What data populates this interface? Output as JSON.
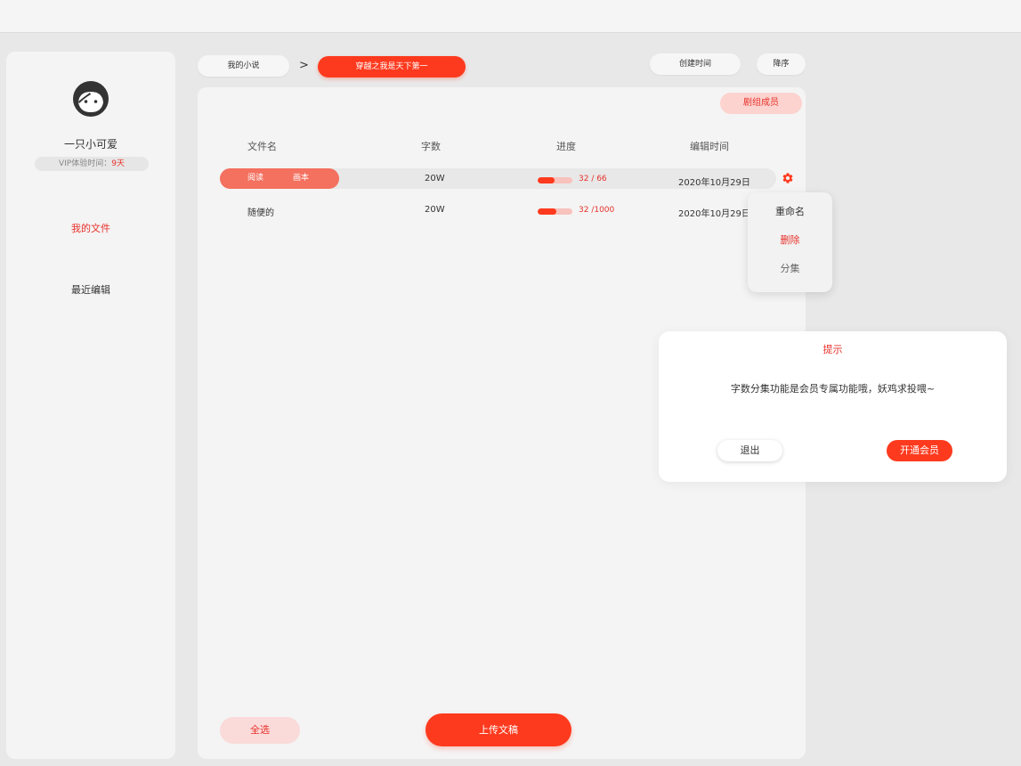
{
  "sidebar": {
    "username": "一只小可爱",
    "vip_label": "VIP体验时间：",
    "vip_days": "9天",
    "nav": [
      {
        "label": "我的文件",
        "active": true
      },
      {
        "label": "最近编辑",
        "active": false
      }
    ]
  },
  "breadcrumb": {
    "root": "我的小说",
    "separator": ">",
    "current": "穿越之我是天下第一"
  },
  "sort": {
    "time_label": "创建时间",
    "order_label": "降序"
  },
  "panel": {
    "crew_button": "剧组成员",
    "headers": {
      "name": "文件名",
      "words": "字数",
      "progress": "进度",
      "edit_time": "编辑时间"
    },
    "row_actions": {
      "read": "阅读",
      "script": "画本"
    },
    "rows": [
      {
        "name": "",
        "words": "20W",
        "progress_text": "32 / 66",
        "progress_fraction": 0.48,
        "edit_time": "2020年10月29日",
        "highlighted": true
      },
      {
        "name": "随便的",
        "words": "20W",
        "progress_text": "32 /1000",
        "progress_fraction": 0.55,
        "edit_time": "2020年10月29日",
        "highlighted": false
      }
    ],
    "select_all": "全选",
    "upload": "上传文稿"
  },
  "context_menu": {
    "items": [
      {
        "label": "重命名",
        "color": "#333333"
      },
      {
        "label": "删除",
        "color": "#e8312a"
      },
      {
        "label": "分集",
        "color": "#666666"
      }
    ]
  },
  "dialog": {
    "title": "提示",
    "message": "字数分集功能是会员专属功能哦，妖鸡求投喂~",
    "cancel": "退出",
    "confirm": "开通会员"
  },
  "colors": {
    "accent": "#fe3a1e",
    "accent_light": "#fcd3cf"
  },
  "icons": {
    "avatar": "girl-face-icon",
    "settings": "gear-icon",
    "separator": "chevron-right-icon"
  }
}
